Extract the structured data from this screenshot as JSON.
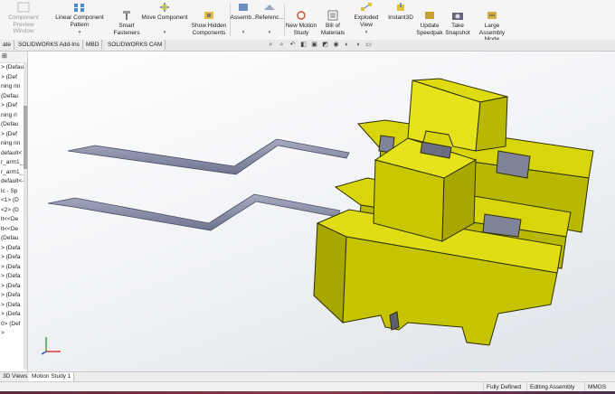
{
  "ribbon": {
    "buttons": [
      {
        "label": "Component\nPreview Window",
        "disabled": true
      },
      {
        "label": "Linear Component Pattern",
        "dropdown": true
      },
      {
        "label": "Smart\nFasteners"
      },
      {
        "label": "Move Component",
        "dropdown": true
      },
      {
        "label": "Show Hidden\nComponents"
      },
      {
        "label": "Assemb...",
        "dropdown": true
      },
      {
        "label": "Referenc...",
        "dropdown": true
      },
      {
        "label": "New Motion\nStudy"
      },
      {
        "label": "Bill of\nMaterials"
      },
      {
        "label": "Exploded View",
        "dropdown": true
      },
      {
        "label": "Instant3D"
      },
      {
        "label": "Update\nSpeedpak"
      },
      {
        "label": "Take\nSnapshot"
      },
      {
        "label": "Large Assembly\nMode"
      }
    ]
  },
  "tabs": [
    {
      "label": "ate",
      "active": false
    },
    {
      "label": "SOLIDWORKS Add-Ins",
      "active": false
    },
    {
      "label": "MBD",
      "active": false
    },
    {
      "label": "SOLIDWORKS CAM",
      "active": false
    }
  ],
  "tree": {
    "rows": [
      "> (Defau",
      "> (Def",
      "ning rin",
      "(Defau",
      "> (Def",
      "ning ri",
      "(Defau",
      "> (Def",
      "ning rin",
      "default<",
      "r_arm1_",
      "r_arm1_",
      "default<-",
      "ic - Sp",
      "<1> (D",
      "<2> (D",
      "lt<<De",
      "lt<<De",
      "(Defau",
      "> (Defa",
      "> (Defa",
      "> (Defa",
      "> (Defa",
      "> (Defa",
      "> (Defa",
      "> (Defa",
      "> (Defa",
      "0> (Def",
      ">"
    ]
  },
  "bottom_tabs": [
    {
      "label": "3D Views",
      "active": false
    },
    {
      "label": "Motion Study 1",
      "active": true
    }
  ],
  "status": {
    "state": "Fully Defined",
    "mode": "Editing Assembly",
    "units": "MMGS"
  },
  "colors": {
    "part_yellow": "#d8d50a",
    "part_gray": "#8a8fa6",
    "viewport_bg": "#eef1f5"
  }
}
